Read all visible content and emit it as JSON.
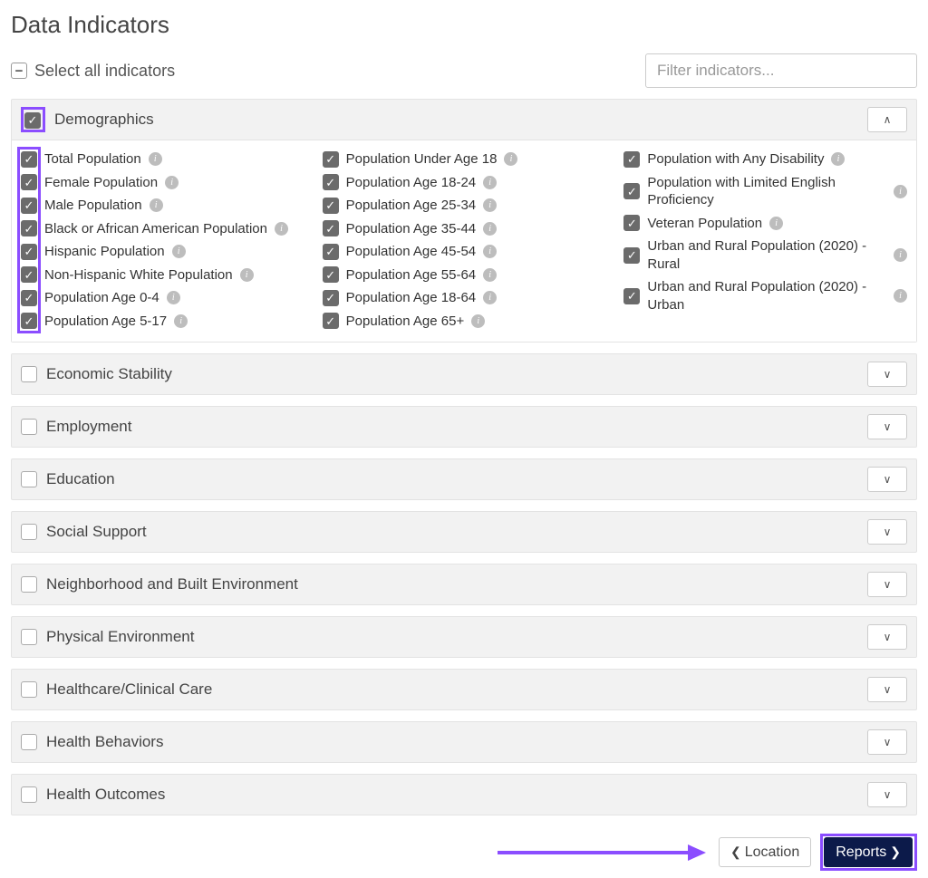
{
  "page_title": "Data Indicators",
  "select_all_label": "Select all indicators",
  "filter_placeholder": "Filter indicators...",
  "categories": [
    {
      "name": "Demographics",
      "checked": true,
      "expanded": true,
      "columns": [
        [
          {
            "label": "Total Population",
            "checked": true,
            "info": true
          },
          {
            "label": "Female Population",
            "checked": true,
            "info": true
          },
          {
            "label": "Male Population",
            "checked": true,
            "info": true
          },
          {
            "label": "Black or African American Population",
            "checked": true,
            "info": true
          },
          {
            "label": "Hispanic Population",
            "checked": true,
            "info": true
          },
          {
            "label": "Non-Hispanic White Population",
            "checked": true,
            "info": true
          },
          {
            "label": "Population Age 0-4",
            "checked": true,
            "info": true
          },
          {
            "label": "Population Age 5-17",
            "checked": true,
            "info": true
          }
        ],
        [
          {
            "label": "Population Under Age 18",
            "checked": true,
            "info": true
          },
          {
            "label": "Population Age 18-24",
            "checked": true,
            "info": true
          },
          {
            "label": "Population Age 25-34",
            "checked": true,
            "info": true
          },
          {
            "label": "Population Age 35-44",
            "checked": true,
            "info": true
          },
          {
            "label": "Population Age 45-54",
            "checked": true,
            "info": true
          },
          {
            "label": "Population Age 55-64",
            "checked": true,
            "info": true
          },
          {
            "label": "Population Age 18-64",
            "checked": true,
            "info": true
          },
          {
            "label": "Population Age 65+",
            "checked": true,
            "info": true
          }
        ],
        [
          {
            "label": "Population with Any Disability",
            "checked": true,
            "info": true
          },
          {
            "label": "Population with Limited English Proficiency",
            "checked": true,
            "info": true,
            "info_below": true
          },
          {
            "label": "Veteran Population",
            "checked": true,
            "info": true
          },
          {
            "label": "Urban and Rural Population (2020) - Rural",
            "checked": true,
            "info": true
          },
          {
            "label": "Urban and Rural Population (2020) - Urban",
            "checked": true,
            "info": true,
            "info_below": true
          }
        ]
      ]
    },
    {
      "name": "Economic Stability",
      "checked": false,
      "expanded": false
    },
    {
      "name": "Employment",
      "checked": false,
      "expanded": false
    },
    {
      "name": "Education",
      "checked": false,
      "expanded": false
    },
    {
      "name": "Social Support",
      "checked": false,
      "expanded": false
    },
    {
      "name": "Neighborhood and Built Environment",
      "checked": false,
      "expanded": false
    },
    {
      "name": "Physical Environment",
      "checked": false,
      "expanded": false
    },
    {
      "name": "Healthcare/Clinical Care",
      "checked": false,
      "expanded": false
    },
    {
      "name": "Health Behaviors",
      "checked": false,
      "expanded": false
    },
    {
      "name": "Health Outcomes",
      "checked": false,
      "expanded": false
    }
  ],
  "footer": {
    "prev_label": "Location",
    "next_label": "Reports"
  }
}
